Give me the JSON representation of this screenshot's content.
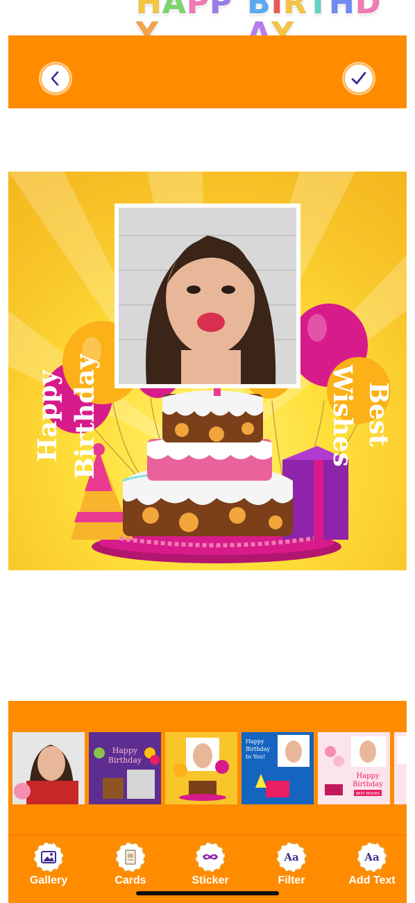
{
  "app": {
    "logo_word1": "HAPPY",
    "logo_word2": "BIRTHDAY",
    "logo_letter_colors": [
      "#F5C542",
      "#7BD66A",
      "#F27AB5",
      "#9B7BEA",
      "#F5A24A",
      "#5AA9F2",
      "#E95A5A",
      "#F5C542",
      "#64D2C3",
      "#6F8CF2",
      "#F27AB5",
      "#B77BF2",
      "#F5C542"
    ]
  },
  "header": {
    "back_icon": "chevron-left-icon",
    "done_icon": "checkmark-icon",
    "accent": "#FF8C00"
  },
  "card": {
    "text_left_1": "Happy",
    "text_left_2": "Birthday",
    "text_right_1": "Best",
    "text_right_2": "Wishes",
    "background": "#F8C62A"
  },
  "templates": [
    {
      "name": "photo-only"
    },
    {
      "name": "purple-happy-birthday",
      "label_1": "Happy",
      "label_2": "Birthday"
    },
    {
      "name": "yellow-best-wishes"
    },
    {
      "name": "blue-happy-birthday",
      "label_1": "Happy",
      "label_2": "Birthday",
      "label_3": "to You!"
    },
    {
      "name": "pink-happy-birthday",
      "label_1": "Happy",
      "label_2": "Birthday",
      "label_3": "BEST WISHES"
    },
    {
      "name": "pink-partial"
    }
  ],
  "tabs": [
    {
      "label": "Gallery",
      "icon": "image-icon"
    },
    {
      "label": "Cards",
      "icon": "cards-icon"
    },
    {
      "label": "Sticker",
      "icon": "mask-icon"
    },
    {
      "label": "Filter",
      "icon": "text-aa-icon",
      "glyph": "Aa"
    },
    {
      "label": "Add Text",
      "icon": "text-aa-icon",
      "glyph": "Aa"
    }
  ]
}
